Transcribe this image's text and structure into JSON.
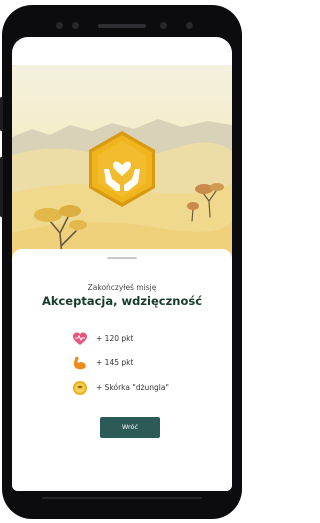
{
  "app": {
    "completed_label": "Zakończyłeś misję",
    "mission_title": "Akceptacja, wdzięczność",
    "rewards": [
      {
        "icon": "heart-icon",
        "text": "+ 120 pkt",
        "color": "#e8557e"
      },
      {
        "icon": "muscle-icon",
        "text": "+ 145 pkt",
        "color": "#f08a1c"
      },
      {
        "icon": "skin-icon",
        "text": "+ Skórka \"dżungla\"",
        "color": "#e9b21e"
      }
    ],
    "button_label": "Wróć"
  },
  "colors": {
    "badge": "#f0b41d",
    "button": "#2c5a57",
    "title": "#173b2a"
  }
}
